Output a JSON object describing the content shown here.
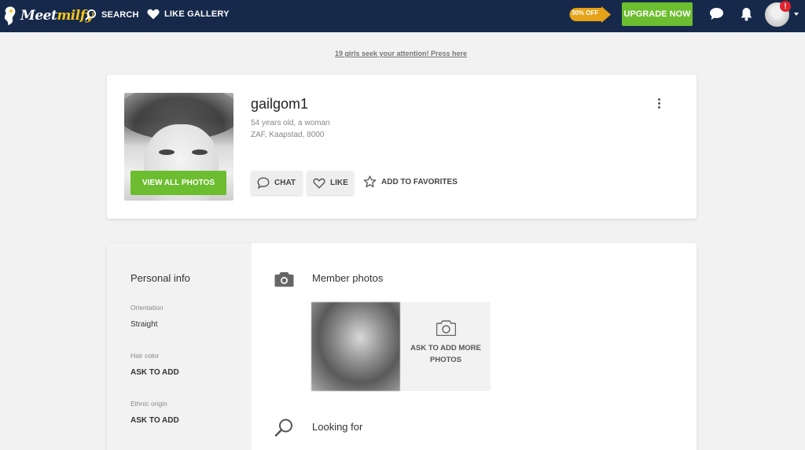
{
  "header": {
    "logo_left": "Meet",
    "logo_right": "milfy",
    "nav": [
      {
        "label": "SEARCH",
        "icon": "search-icon"
      },
      {
        "label": "LIKE GALLERY",
        "icon": "heart-icon"
      }
    ],
    "discount": "30% OFF",
    "upgrade_label": "UPGRADE NOW",
    "notification_badge": "!",
    "colors": {
      "bar": "#16294a",
      "accent_green": "#6cbd2f",
      "discount_gold": "#e6a317",
      "badge_red": "#e0242c"
    }
  },
  "notice": "19 girls seek your attention! Press here",
  "profile": {
    "username": "gailgom1",
    "age_gender": "54 years old, a woman",
    "location": "ZAF, Kaapstad, 8000",
    "view_photos_label": "VIEW ALL PHOTOS",
    "actions": {
      "chat": "CHAT",
      "like": "LIKE",
      "favorites": "ADD TO FAVORITES"
    }
  },
  "personal_info": {
    "title": "Personal info",
    "fields": [
      {
        "label": "Orientation",
        "value": "Straight"
      },
      {
        "label": "Hair color",
        "value": "ASK TO ADD"
      },
      {
        "label": "Ethnic origin",
        "value": "ASK TO ADD"
      }
    ]
  },
  "member_photos": {
    "title": "Member photos",
    "ask_more_label": "ASK TO ADD MORE PHOTOS"
  },
  "looking_for": {
    "title": "Looking for"
  }
}
